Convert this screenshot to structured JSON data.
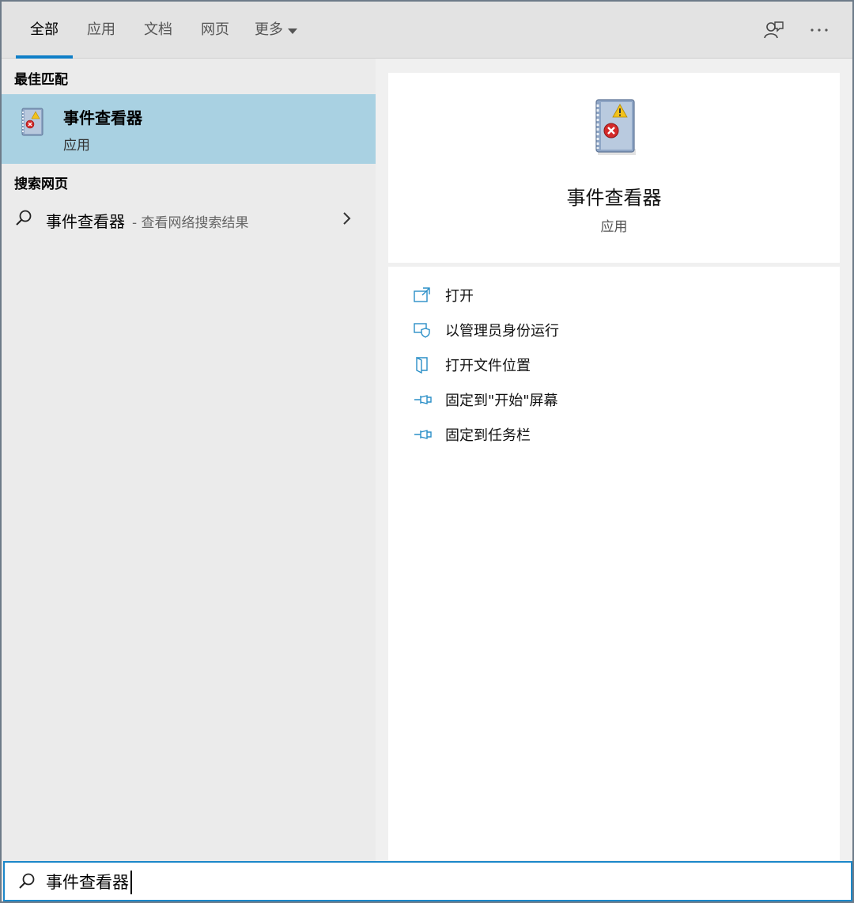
{
  "tabs": [
    {
      "label": "全部",
      "active": true
    },
    {
      "label": "应用",
      "active": false
    },
    {
      "label": "文档",
      "active": false
    },
    {
      "label": "网页",
      "active": false
    },
    {
      "label": "更多",
      "active": false
    }
  ],
  "top_icons": [
    "feedback-icon",
    "more-options-icon"
  ],
  "left": {
    "best_match_heading": "最佳匹配",
    "best_match": {
      "title": "事件查看器",
      "subtitle": "应用",
      "icon": "event-viewer-icon"
    },
    "web_heading": "搜索网页",
    "web_result": {
      "query": "事件查看器",
      "suffix": "- 查看网络搜索结果"
    }
  },
  "detail": {
    "title": "事件查看器",
    "subtitle": "应用",
    "actions": [
      {
        "label": "打开",
        "icon": "open-icon"
      },
      {
        "label": "以管理员身份运行",
        "icon": "shield-icon"
      },
      {
        "label": "打开文件位置",
        "icon": "file-location-icon"
      },
      {
        "label": "固定到\"开始\"屏幕",
        "icon": "pin-icon"
      },
      {
        "label": "固定到任务栏",
        "icon": "pin-icon"
      }
    ]
  },
  "search": {
    "value": "事件查看器"
  },
  "colors": {
    "accent": "#0f7fc7",
    "selection": "#a9d1e2",
    "action_icon": "#2a8fc7"
  }
}
